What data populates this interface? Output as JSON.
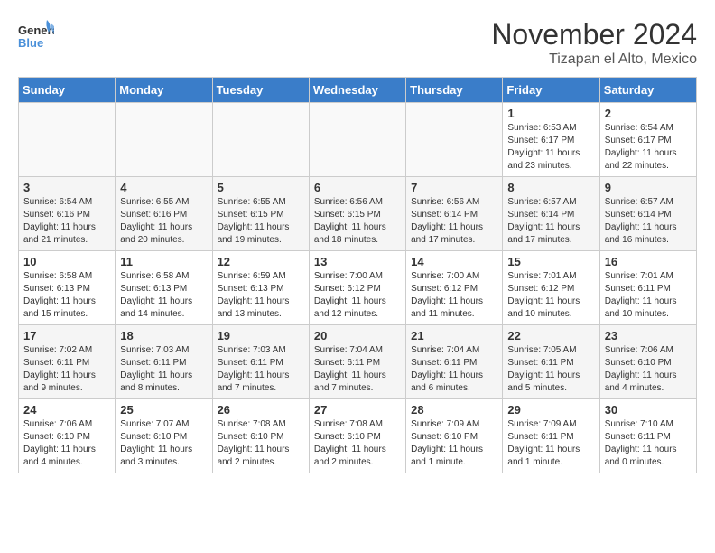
{
  "header": {
    "logo_general": "General",
    "logo_blue": "Blue",
    "month": "November 2024",
    "location": "Tizapan el Alto, Mexico"
  },
  "days_of_week": [
    "Sunday",
    "Monday",
    "Tuesday",
    "Wednesday",
    "Thursday",
    "Friday",
    "Saturday"
  ],
  "weeks": [
    [
      {
        "day": "",
        "info": ""
      },
      {
        "day": "",
        "info": ""
      },
      {
        "day": "",
        "info": ""
      },
      {
        "day": "",
        "info": ""
      },
      {
        "day": "",
        "info": ""
      },
      {
        "day": "1",
        "info": "Sunrise: 6:53 AM\nSunset: 6:17 PM\nDaylight: 11 hours and 23 minutes."
      },
      {
        "day": "2",
        "info": "Sunrise: 6:54 AM\nSunset: 6:17 PM\nDaylight: 11 hours and 22 minutes."
      }
    ],
    [
      {
        "day": "3",
        "info": "Sunrise: 6:54 AM\nSunset: 6:16 PM\nDaylight: 11 hours and 21 minutes."
      },
      {
        "day": "4",
        "info": "Sunrise: 6:55 AM\nSunset: 6:16 PM\nDaylight: 11 hours and 20 minutes."
      },
      {
        "day": "5",
        "info": "Sunrise: 6:55 AM\nSunset: 6:15 PM\nDaylight: 11 hours and 19 minutes."
      },
      {
        "day": "6",
        "info": "Sunrise: 6:56 AM\nSunset: 6:15 PM\nDaylight: 11 hours and 18 minutes."
      },
      {
        "day": "7",
        "info": "Sunrise: 6:56 AM\nSunset: 6:14 PM\nDaylight: 11 hours and 17 minutes."
      },
      {
        "day": "8",
        "info": "Sunrise: 6:57 AM\nSunset: 6:14 PM\nDaylight: 11 hours and 17 minutes."
      },
      {
        "day": "9",
        "info": "Sunrise: 6:57 AM\nSunset: 6:14 PM\nDaylight: 11 hours and 16 minutes."
      }
    ],
    [
      {
        "day": "10",
        "info": "Sunrise: 6:58 AM\nSunset: 6:13 PM\nDaylight: 11 hours and 15 minutes."
      },
      {
        "day": "11",
        "info": "Sunrise: 6:58 AM\nSunset: 6:13 PM\nDaylight: 11 hours and 14 minutes."
      },
      {
        "day": "12",
        "info": "Sunrise: 6:59 AM\nSunset: 6:13 PM\nDaylight: 11 hours and 13 minutes."
      },
      {
        "day": "13",
        "info": "Sunrise: 7:00 AM\nSunset: 6:12 PM\nDaylight: 11 hours and 12 minutes."
      },
      {
        "day": "14",
        "info": "Sunrise: 7:00 AM\nSunset: 6:12 PM\nDaylight: 11 hours and 11 minutes."
      },
      {
        "day": "15",
        "info": "Sunrise: 7:01 AM\nSunset: 6:12 PM\nDaylight: 11 hours and 10 minutes."
      },
      {
        "day": "16",
        "info": "Sunrise: 7:01 AM\nSunset: 6:11 PM\nDaylight: 11 hours and 10 minutes."
      }
    ],
    [
      {
        "day": "17",
        "info": "Sunrise: 7:02 AM\nSunset: 6:11 PM\nDaylight: 11 hours and 9 minutes."
      },
      {
        "day": "18",
        "info": "Sunrise: 7:03 AM\nSunset: 6:11 PM\nDaylight: 11 hours and 8 minutes."
      },
      {
        "day": "19",
        "info": "Sunrise: 7:03 AM\nSunset: 6:11 PM\nDaylight: 11 hours and 7 minutes."
      },
      {
        "day": "20",
        "info": "Sunrise: 7:04 AM\nSunset: 6:11 PM\nDaylight: 11 hours and 7 minutes."
      },
      {
        "day": "21",
        "info": "Sunrise: 7:04 AM\nSunset: 6:11 PM\nDaylight: 11 hours and 6 minutes."
      },
      {
        "day": "22",
        "info": "Sunrise: 7:05 AM\nSunset: 6:11 PM\nDaylight: 11 hours and 5 minutes."
      },
      {
        "day": "23",
        "info": "Sunrise: 7:06 AM\nSunset: 6:10 PM\nDaylight: 11 hours and 4 minutes."
      }
    ],
    [
      {
        "day": "24",
        "info": "Sunrise: 7:06 AM\nSunset: 6:10 PM\nDaylight: 11 hours and 4 minutes."
      },
      {
        "day": "25",
        "info": "Sunrise: 7:07 AM\nSunset: 6:10 PM\nDaylight: 11 hours and 3 minutes."
      },
      {
        "day": "26",
        "info": "Sunrise: 7:08 AM\nSunset: 6:10 PM\nDaylight: 11 hours and 2 minutes."
      },
      {
        "day": "27",
        "info": "Sunrise: 7:08 AM\nSunset: 6:10 PM\nDaylight: 11 hours and 2 minutes."
      },
      {
        "day": "28",
        "info": "Sunrise: 7:09 AM\nSunset: 6:10 PM\nDaylight: 11 hours and 1 minute."
      },
      {
        "day": "29",
        "info": "Sunrise: 7:09 AM\nSunset: 6:11 PM\nDaylight: 11 hours and 1 minute."
      },
      {
        "day": "30",
        "info": "Sunrise: 7:10 AM\nSunset: 6:11 PM\nDaylight: 11 hours and 0 minutes."
      }
    ]
  ]
}
